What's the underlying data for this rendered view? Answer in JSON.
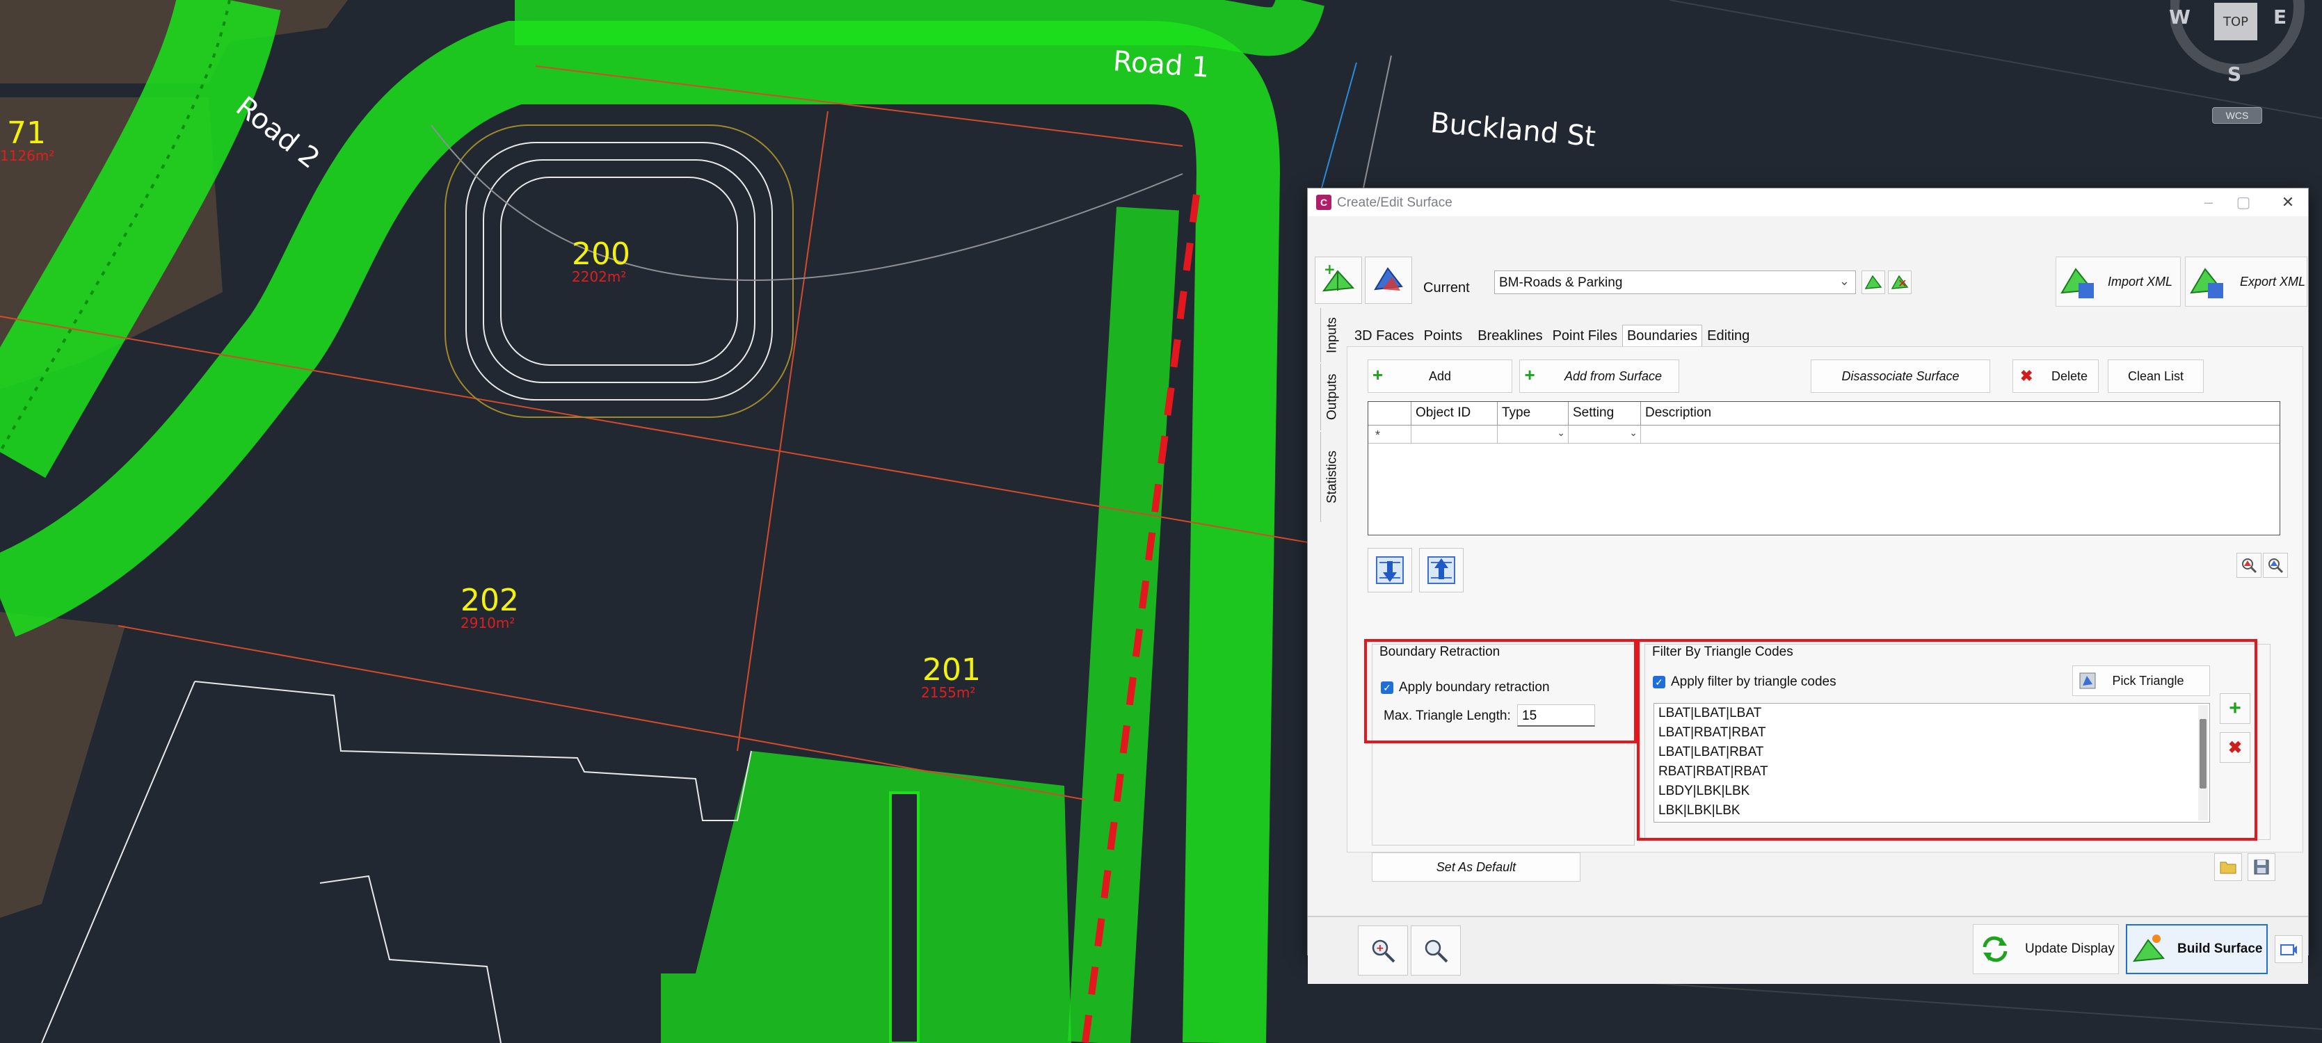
{
  "cad": {
    "lots": [
      {
        "number": "71",
        "area": "1126m²"
      },
      {
        "number": "200",
        "area": "2202m²"
      },
      {
        "number": "202",
        "area": "2910m²"
      },
      {
        "number": "201",
        "area": "2155m²"
      }
    ],
    "roads": {
      "road_2": "Road 2",
      "road_1": "Road 1",
      "buckland": "Buckland St"
    },
    "compass": {
      "w": "W",
      "e": "E",
      "s": "S",
      "top": "TOP",
      "wcs": "WCS"
    }
  },
  "dialog": {
    "title": "Create/Edit Surface",
    "current_label": "Current",
    "current_surface": "BM-Roads & Parking",
    "import_xml": "Import XML",
    "export_xml": "Export XML",
    "side_tabs": [
      "Inputs",
      "Outputs",
      "Statistics"
    ],
    "tabs": [
      "3D Faces",
      "Points",
      "Breaklines",
      "Point Files",
      "Boundaries",
      "Editing"
    ],
    "active_tab": "Boundaries",
    "toolbar": {
      "add": "Add",
      "add_from_surface": "Add from Surface",
      "disassociate": "Disassociate Surface",
      "delete": "Delete",
      "clean_list": "Clean List"
    },
    "grid": {
      "columns": [
        "Object ID",
        "Type",
        "Setting",
        "Description"
      ],
      "new_row_marker": "*"
    },
    "boundary_retraction": {
      "title": "Boundary Retraction",
      "apply_label": "Apply boundary retraction",
      "apply_checked": true,
      "max_len_label": "Max. Triangle Length:",
      "max_len_value": "15"
    },
    "filter": {
      "title": "Filter By Triangle Codes",
      "apply_label": "Apply filter by triangle codes",
      "apply_checked": true,
      "pick_triangle": "Pick Triangle",
      "codes": [
        "LBAT|LBAT|LBAT",
        "LBAT|RBAT|RBAT",
        "LBAT|LBAT|RBAT",
        "RBAT|RBAT|RBAT",
        "LBDY|LBK|LBK",
        "LBK|LBK|LBK"
      ]
    },
    "set_default": "Set As Default",
    "update_display": "Update Display",
    "build_surface": "Build Surface"
  }
}
